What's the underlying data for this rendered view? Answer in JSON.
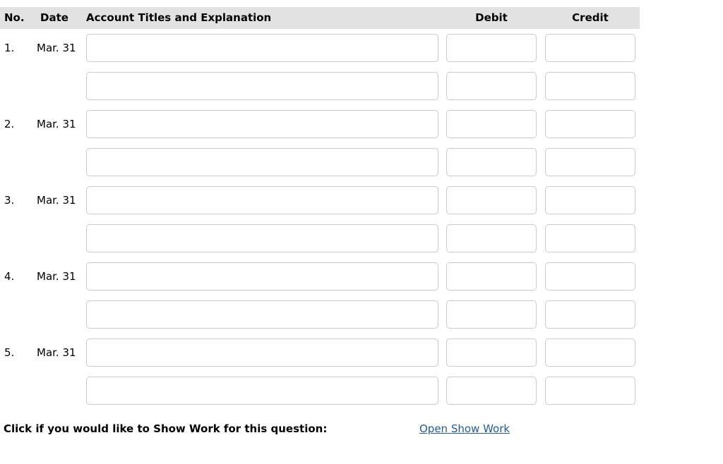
{
  "table": {
    "columns": {
      "no": "No.",
      "date": "Date",
      "account": "Account Titles and Explanation",
      "debit": "Debit",
      "credit": "Credit"
    },
    "header_bg": "#e2e2e2",
    "input_border": "#cbcbcb",
    "entries": [
      {
        "no": "1.",
        "date": "Mar. 31",
        "lines": [
          {
            "account": "",
            "debit": "",
            "credit": "",
            "account_placeholder": "",
            "debit_placeholder": "",
            "credit_placeholder": ""
          },
          {
            "account": "",
            "debit": "",
            "credit": "",
            "account_placeholder": "",
            "debit_placeholder": "",
            "credit_placeholder": ""
          }
        ]
      },
      {
        "no": "2.",
        "date": "Mar. 31",
        "lines": [
          {
            "account": "",
            "debit": "",
            "credit": "",
            "account_placeholder": "",
            "debit_placeholder": "",
            "credit_placeholder": ""
          },
          {
            "account": "",
            "debit": "",
            "credit": "",
            "account_placeholder": "",
            "debit_placeholder": "",
            "credit_placeholder": ""
          }
        ]
      },
      {
        "no": "3.",
        "date": "Mar. 31",
        "lines": [
          {
            "account": "",
            "debit": "",
            "credit": "",
            "account_placeholder": "",
            "debit_placeholder": "",
            "credit_placeholder": ""
          },
          {
            "account": "",
            "debit": "",
            "credit": "",
            "account_placeholder": "",
            "debit_placeholder": "",
            "credit_placeholder": ""
          }
        ]
      },
      {
        "no": "4.",
        "date": "Mar. 31",
        "lines": [
          {
            "account": "",
            "debit": "",
            "credit": "",
            "account_placeholder": "",
            "debit_placeholder": "",
            "credit_placeholder": ""
          },
          {
            "account": "",
            "debit": "",
            "credit": "",
            "account_placeholder": "",
            "debit_placeholder": "",
            "credit_placeholder": ""
          }
        ]
      },
      {
        "no": "5.",
        "date": "Mar. 31",
        "lines": [
          {
            "account": "",
            "debit": "",
            "credit": "",
            "account_placeholder": "",
            "debit_placeholder": "",
            "credit_placeholder": ""
          },
          {
            "account": "",
            "debit": "",
            "credit": "",
            "account_placeholder": "",
            "debit_placeholder": "",
            "credit_placeholder": ""
          }
        ]
      }
    ]
  },
  "footer": {
    "label": "Click if you would like to Show Work for this question:",
    "link_label": "Open Show Work",
    "link_color": "#1f5c99"
  }
}
